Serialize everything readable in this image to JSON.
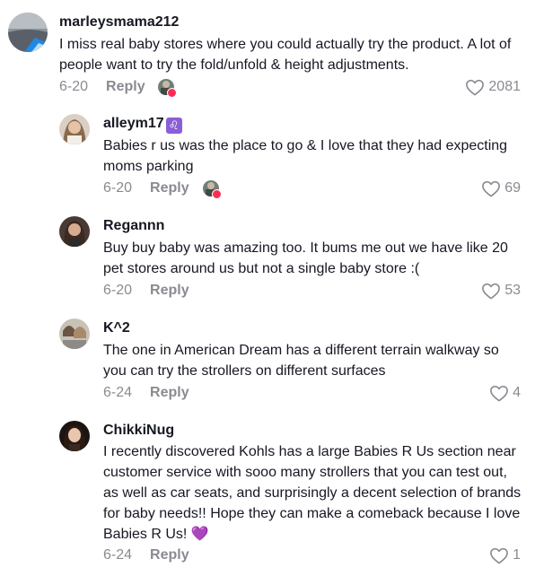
{
  "comments": [
    {
      "username": "marleysmama212",
      "text": "I miss real baby stores where you could actually try the product. A lot of people want to try the fold/unfold & height adjustments.",
      "date": "6-20",
      "reply_label": "Reply",
      "likes": "2081",
      "creator_liked": true
    },
    {
      "username": "alleym17",
      "badge": "♌",
      "text": "Babies r us was the place to go & I love that they had expecting moms parking",
      "date": "6-20",
      "reply_label": "Reply",
      "likes": "69",
      "creator_liked": true
    },
    {
      "username": "Regannn",
      "text": "Buy buy baby was amazing too. It bums me out we have like 20 pet stores around us but not a single baby store :(",
      "date": "6-20",
      "reply_label": "Reply",
      "likes": "53",
      "creator_liked": false
    },
    {
      "username": "K^2",
      "text": "The one in American Dream has a different terrain walkway so you can try the strollers on different surfaces",
      "date": "6-24",
      "reply_label": "Reply",
      "likes": "4",
      "creator_liked": false
    },
    {
      "username": "ChikkiNug",
      "text": "I recently discovered Kohls has a large Babies R Us section near customer service with sooo many strollers that you can test out, as well as car seats, and surprisingly a decent selection of brands for baby needs!! Hope they can make a comeback because I love Babies R Us!",
      "emoji": "💜",
      "date": "6-24",
      "reply_label": "Reply",
      "likes": "1",
      "creator_liked": false
    }
  ],
  "colors": {
    "text": "#161823",
    "meta": "#8a8b91",
    "creator_heart": "#fe2c55",
    "badge": "#8a5fd6",
    "emoji_heart": "#8e5cd9"
  }
}
